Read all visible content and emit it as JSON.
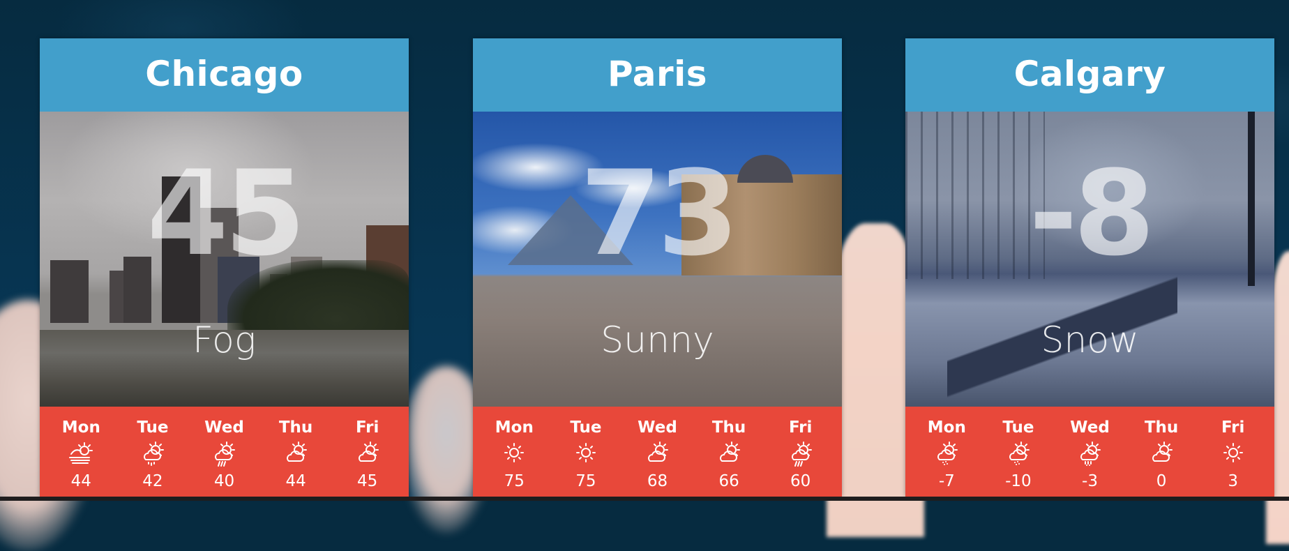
{
  "cities": [
    {
      "name": "Chicago",
      "current_temp": "45",
      "condition": "Fog",
      "forecast": [
        {
          "day": "Mon",
          "icon": "fog-sun-icon",
          "temp": "44"
        },
        {
          "day": "Tue",
          "icon": "drizzle-sun-icon",
          "temp": "42"
        },
        {
          "day": "Wed",
          "icon": "rain-sun-icon",
          "temp": "40"
        },
        {
          "day": "Thu",
          "icon": "partly-cloudy-icon",
          "temp": "44"
        },
        {
          "day": "Fri",
          "icon": "partly-cloudy-icon",
          "temp": "45"
        }
      ]
    },
    {
      "name": "Paris",
      "current_temp": "73",
      "condition": "Sunny",
      "forecast": [
        {
          "day": "Mon",
          "icon": "sun-icon",
          "temp": "75"
        },
        {
          "day": "Tue",
          "icon": "sun-icon",
          "temp": "75"
        },
        {
          "day": "Wed",
          "icon": "partly-cloudy-icon",
          "temp": "68"
        },
        {
          "day": "Thu",
          "icon": "partly-cloudy-icon",
          "temp": "66"
        },
        {
          "day": "Fri",
          "icon": "rain-sun-icon",
          "temp": "60"
        }
      ]
    },
    {
      "name": "Calgary",
      "current_temp": "-8",
      "condition": "Snow",
      "forecast": [
        {
          "day": "Mon",
          "icon": "snow-sun-icon",
          "temp": "-7"
        },
        {
          "day": "Tue",
          "icon": "snow-sun-icon",
          "temp": "-10"
        },
        {
          "day": "Wed",
          "icon": "sleet-sun-icon",
          "temp": "-3"
        },
        {
          "day": "Thu",
          "icon": "partly-cloudy-icon",
          "temp": "0"
        },
        {
          "day": "Fri",
          "icon": "sun-icon",
          "temp": "3"
        }
      ]
    }
  ],
  "colors": {
    "header": "#429fcb",
    "forecast": "#e8483a",
    "background": "#062b40"
  }
}
